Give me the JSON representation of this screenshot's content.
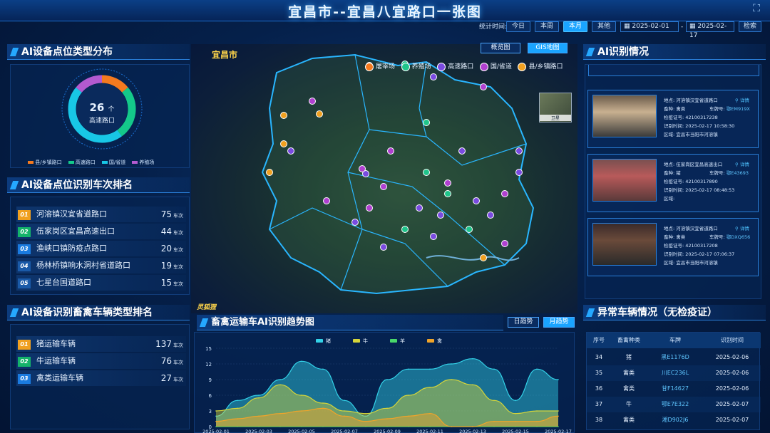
{
  "header": {
    "title": "宜昌市--宜昌八宜路口一张图"
  },
  "filter": {
    "label": "统计时间:",
    "buttons": [
      "今日",
      "本周",
      "本月",
      "其他"
    ],
    "active": "本月",
    "start_date": "2025-02-01",
    "separator": "-",
    "end_date": "2025-02-17",
    "search_label": "检索"
  },
  "type_dist": {
    "title": "AI设备点位类型分布",
    "center_value": "26",
    "center_unit": "个",
    "center_label": "高速路口",
    "legend": [
      {
        "name": "县/乡镇路口",
        "color": "#f47a1f"
      },
      {
        "name": "高速路口",
        "color": "#14c98a"
      },
      {
        "name": "国/省道",
        "color": "#18c7e6"
      },
      {
        "name": "养殖场",
        "color": "#b35ad0"
      }
    ],
    "slices": [
      {
        "name": "县/乡镇路口",
        "value": 14
      },
      {
        "name": "高速路口",
        "value": 26
      },
      {
        "name": "国/省道",
        "value": 46
      },
      {
        "name": "养殖场",
        "value": 14
      }
    ]
  },
  "rank_points": {
    "title": "AI设备点位识别车次排名",
    "unit": "车次",
    "rows": [
      {
        "no": "01",
        "name": "河溶镇汉宜省道路口",
        "count": "75"
      },
      {
        "no": "02",
        "name": "伍家岗区宜昌高速出口",
        "count": "44"
      },
      {
        "no": "03",
        "name": "渔峡口镇防疫点路口",
        "count": "20"
      },
      {
        "no": "04",
        "name": "杨林桥镇响水洞村省道路口",
        "count": "19"
      },
      {
        "no": "05",
        "name": "七星台国道路口",
        "count": "15"
      }
    ]
  },
  "rank_types": {
    "title": "AI设备识别畜禽车辆类型排名",
    "unit": "车次",
    "rows": [
      {
        "no": "01",
        "name": "猪运输车辆",
        "count": "137"
      },
      {
        "no": "02",
        "name": "牛运输车辆",
        "count": "76"
      },
      {
        "no": "03",
        "name": "禽类运输车辆",
        "count": "27"
      }
    ]
  },
  "map": {
    "city": "宜昌市",
    "tabs": [
      "概览图",
      "GIS地图"
    ],
    "active_tab": "GIS地图",
    "satellite_label": "卫星",
    "legend": [
      {
        "name": "屠宰场",
        "color": "#f47a1f"
      },
      {
        "name": "养殖场",
        "color": "#1fc48a"
      },
      {
        "name": "高速路口",
        "color": "#7a4be0"
      },
      {
        "name": "国/省道",
        "color": "#b040d0"
      },
      {
        "name": "县/乡镇路口",
        "color": "#f0a020"
      }
    ],
    "logo_text": "灵狐狸"
  },
  "ai_recog": {
    "title": "AI识别情况",
    "cards": [
      {
        "place_label": "地点:",
        "place": "河溶镇汉宜省道路口",
        "detail": "详情",
        "kind_label": "畜种:",
        "kind": "禽类",
        "plate_label": "车牌号:",
        "plate": "鄂EM919X",
        "cert_label": "检疫证号:",
        "cert": "42100317238",
        "time_label": "识别时间:",
        "time": "2025-02-17 10:58:30",
        "area_label": "区域:",
        "area": "宜昌市当阳市河溶镇"
      },
      {
        "place_label": "地点:",
        "place": "伍家岗区宜昌高速出口",
        "detail": "详情",
        "kind_label": "畜种:",
        "kind": "猪",
        "plate_label": "车牌号:",
        "plate": "鄂E43693",
        "cert_label": "检疫证号:",
        "cert": "42100317890",
        "time_label": "识别时间:",
        "time": "2025-02-17 08:48:53",
        "area_label": "区域:",
        "area": ""
      },
      {
        "place_label": "地点:",
        "place": "河溶镇汉宜省道路口",
        "detail": "详情",
        "kind_label": "畜种:",
        "kind": "禽类",
        "plate_label": "车牌号:",
        "plate": "鄂DXQ656",
        "cert_label": "检疫证号:",
        "cert": "42100317208",
        "time_label": "识别时间:",
        "time": "2025-02-17 07:06:37",
        "area_label": "区域:",
        "area": "宜昌市当阳市河溶镇"
      }
    ]
  },
  "abnormal": {
    "title": "异常车辆情况（无检疫证）",
    "headers": [
      "序号",
      "畜禽种类",
      "车牌",
      "识别时间"
    ],
    "rows": [
      {
        "no": "34",
        "kind": "猪",
        "plate": "黑E1176D",
        "date": "2025-02-06"
      },
      {
        "no": "35",
        "kind": "禽类",
        "plate": "川EC236L",
        "date": "2025-02-06"
      },
      {
        "no": "36",
        "kind": "禽类",
        "plate": "甘F14627",
        "date": "2025-02-06"
      },
      {
        "no": "37",
        "kind": "牛",
        "plate": "鄂E7E322",
        "date": "2025-02-07"
      },
      {
        "no": "38",
        "kind": "禽类",
        "plate": "湘D902J6",
        "date": "2025-02-07"
      }
    ]
  },
  "trend": {
    "title": "畜禽运输车AI识别趋势图",
    "tabs": [
      "日趋势",
      "月趋势"
    ],
    "active_tab": "月趋势"
  },
  "chart_data": {
    "type": "area",
    "x": [
      "2025-02-01",
      "2025-02-02",
      "2025-02-03",
      "2025-02-04",
      "2025-02-05",
      "2025-02-06",
      "2025-02-07",
      "2025-02-08",
      "2025-02-09",
      "2025-02-10",
      "2025-02-11",
      "2025-02-12",
      "2025-02-13",
      "2025-02-14",
      "2025-02-15",
      "2025-02-16",
      "2025-02-17"
    ],
    "tick_labels": [
      "2025-02-01",
      "2025-02-03",
      "2025-02-05",
      "2025-02-07",
      "2025-02-09",
      "2025-02-11",
      "2025-02-13",
      "2025-02-15",
      "2025-02-17"
    ],
    "ylim": [
      0,
      15
    ],
    "yticks": [
      0,
      3,
      6,
      9,
      12,
      15
    ],
    "grid": true,
    "legend_position": "top-center",
    "series": [
      {
        "name": "猪",
        "color": "#33d2e8",
        "values": [
          2,
          5,
          6,
          9,
          12.5,
          11,
          5,
          2,
          9,
          11,
          11,
          12,
          13,
          11,
          5,
          11,
          9
        ]
      },
      {
        "name": "牛",
        "color": "#d6d63a",
        "values": [
          3,
          3.5,
          5.5,
          8,
          6,
          4.5,
          3,
          2.5,
          3.5,
          6,
          7.5,
          9,
          8,
          5,
          2.5,
          3,
          3
        ]
      },
      {
        "name": "羊",
        "color": "#49d86a",
        "values": [
          0,
          0,
          0,
          0,
          0,
          0,
          0,
          0,
          0,
          0,
          0,
          0,
          0,
          0,
          0,
          0,
          0
        ]
      },
      {
        "name": "禽",
        "color": "#f0a42a",
        "values": [
          1,
          1.5,
          2,
          2.5,
          3,
          3.5,
          2,
          1,
          1.5,
          2,
          2.5,
          0,
          0,
          1,
          1,
          1,
          2
        ]
      }
    ]
  }
}
